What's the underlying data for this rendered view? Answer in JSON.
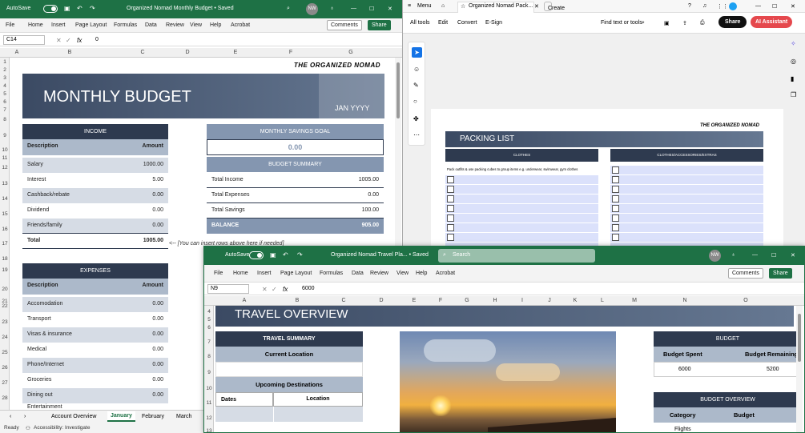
{
  "excel1": {
    "autosave": "AutoSave",
    "doc_title": "Organized Nomad Monthly Budget • Saved",
    "avatar": "NW",
    "menu": [
      "File",
      "Home",
      "Insert",
      "Page Layout",
      "Formulas",
      "Data",
      "Review",
      "View",
      "Help",
      "Acrobat"
    ],
    "comments": "Comments",
    "share": "Share",
    "cell_ref": "C14",
    "formula": "0",
    "columns": [
      "A",
      "B",
      "C",
      "D",
      "E",
      "F",
      "G"
    ],
    "rows": [
      "1",
      "2",
      "3",
      "4",
      "5",
      "6",
      "7",
      "8",
      "9",
      "10",
      "11",
      "12",
      "13",
      "14",
      "15",
      "16",
      "17",
      "18",
      "19",
      "20",
      "21",
      "22",
      "23",
      "24",
      "25",
      "26",
      "27",
      "28"
    ],
    "brand": "THE ORGANIZED NOMAD",
    "banner_title": "MONTHLY BUDGET",
    "banner_date": "JAN YYYY",
    "income": {
      "header": "INCOME",
      "col_desc": "Description",
      "col_amt": "Amount",
      "rows": [
        {
          "label": "Salary",
          "value": "1000.00"
        },
        {
          "label": "Interest",
          "value": "5.00"
        },
        {
          "label": "Cashback/rebate",
          "value": "0.00"
        },
        {
          "label": "Dividend",
          "value": "0.00"
        },
        {
          "label": "Friends/family",
          "value": "0.00"
        }
      ],
      "total_label": "Total",
      "total_value": "1005.00",
      "note": "<-- [You can insert rows above here if needed]"
    },
    "savings_goal": {
      "header": "MONTHLY SAVINGS GOAL",
      "value": "0.00"
    },
    "summary": {
      "header": "BUDGET SUMMARY",
      "rows": [
        {
          "label": "Total Income",
          "value": "1005.00"
        },
        {
          "label": "Total Expenses",
          "value": "0.00"
        },
        {
          "label": "Total Savings",
          "value": "100.00"
        }
      ],
      "balance_label": "BALANCE",
      "balance_value": "905.00"
    },
    "expenses": {
      "header": "EXPENSES",
      "col_desc": "Description",
      "col_amt": "Amount",
      "rows": [
        {
          "label": "Accomodation",
          "value": "0.00"
        },
        {
          "label": "Transport",
          "value": "0.00"
        },
        {
          "label": "Visas & insurance",
          "value": "0.00"
        },
        {
          "label": "Medical",
          "value": "0.00"
        },
        {
          "label": "Phone/Internet",
          "value": "0.00"
        },
        {
          "label": "Groceries",
          "value": "0.00"
        },
        {
          "label": "Dining out",
          "value": "0.00"
        },
        {
          "label": "Entertainment",
          "value": ""
        }
      ]
    },
    "sheet_tabs": [
      "Account Overview",
      "January",
      "February",
      "March"
    ],
    "status_ready": "Ready",
    "status_accessibility": "Accessibility: Investigate"
  },
  "pdf": {
    "menu": "Menu",
    "tab_title": "Organized Nomad Pack...",
    "create": "Create",
    "tools": [
      "All tools",
      "Edit",
      "Convert",
      "E-Sign"
    ],
    "find": "Find text or tools",
    "share": "Share",
    "ai": "AI Assistant",
    "page_brand": "THE ORGANIZED NOMAD",
    "page_title": "PACKING LIST",
    "col1": "CLOTHES",
    "col2": "CLOTHES/ACCESSORIES/EXTRAS",
    "tip": "Pack outfits & use packing cubes to group items e.g. underwear, swimwear, gym clothes"
  },
  "excel2": {
    "autosave": "AutoSave",
    "doc_title": "Organized Nomad Travel Pla... • Saved",
    "search": "Search",
    "avatar": "NW",
    "menu": [
      "File",
      "Home",
      "Insert",
      "Page Layout",
      "Formulas",
      "Data",
      "Review",
      "View",
      "Help",
      "Acrobat"
    ],
    "comments": "Comments",
    "share": "Share",
    "cell_ref": "N9",
    "formula": "6000",
    "columns": [
      "A",
      "B",
      "C",
      "D",
      "E",
      "F",
      "G",
      "H",
      "I",
      "J",
      "K",
      "L",
      "M",
      "N",
      "O"
    ],
    "rows": [
      "4",
      "5",
      "6",
      "7",
      "8",
      "9",
      "10",
      "11",
      "12",
      "13"
    ],
    "banner_title": "TRAVEL OVERVIEW",
    "travel_summary": "TRAVEL SUMMARY",
    "current_location": "Current Location",
    "upcoming": "Upcoming Destinations",
    "dates": "Dates",
    "location": "Location",
    "budget": "BUDGET",
    "budget_spent": "Budget Spent",
    "budget_remaining": "Budget Remaining",
    "spent_value": "6000",
    "remaining_value": "5200",
    "budget_overview": "BUDGET OVERVIEW",
    "category": "Category",
    "budget_col": "Budget",
    "flights": "Flights"
  }
}
